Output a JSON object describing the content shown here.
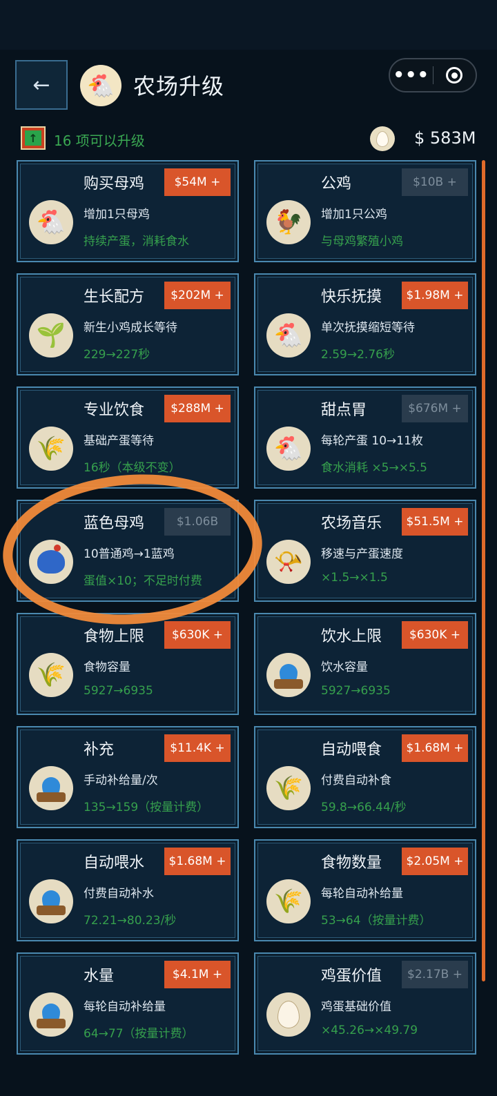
{
  "header": {
    "back_icon": "←",
    "title": "农场升级",
    "more_icon": "•••"
  },
  "info": {
    "upgrade_count": "16 项可以升级",
    "money": "$ 583M"
  },
  "colors": {
    "accent": "#d9552a",
    "effect_green": "#36a04d",
    "card_border": "#4a89b0",
    "annotation": "#f08a3a"
  },
  "cards": [
    {
      "title": "购买母鸡",
      "price": "$54M +",
      "price_active": true,
      "icon": "hen-icon",
      "desc": "增加1只母鸡",
      "effect": "持续产蛋，消耗食水"
    },
    {
      "title": "公鸡",
      "price": "$10B +",
      "price_active": false,
      "icon": "rooster-icon",
      "desc": "增加1只公鸡",
      "effect": "与母鸡繁殖小鸡"
    },
    {
      "title": "生长配方",
      "price": "$202M +",
      "price_active": true,
      "icon": "sprout-icon",
      "desc": "新生小鸡成长等待",
      "effect": "229→227秒"
    },
    {
      "title": "快乐抚摸",
      "price": "$1.98M +",
      "price_active": true,
      "icon": "petting-hen-icon",
      "desc": "单次抚摸缩短等待",
      "effect": "2.59→2.76秒"
    },
    {
      "title": "专业饮食",
      "price": "$288M +",
      "price_active": true,
      "icon": "grain-sack-icon",
      "desc": "基础产蛋等待",
      "effect": "16秒（本级不变）"
    },
    {
      "title": "甜点胃",
      "price": "$676M +",
      "price_active": false,
      "icon": "petting-hen-icon",
      "desc": "每轮产蛋 10→11枚",
      "effect": "食水消耗 ×5→×5.5"
    },
    {
      "title": "蓝色母鸡",
      "price": "$1.06B",
      "price_active": false,
      "icon": "blue-hen-icon",
      "desc": "10普通鸡→1蓝鸡",
      "effect": "蛋值×10；不足时付费"
    },
    {
      "title": "农场音乐",
      "price": "$51.5M +",
      "price_active": true,
      "icon": "gramophone-icon",
      "desc": "移速与产蛋速度",
      "effect": "×1.5→×1.5"
    },
    {
      "title": "食物上限",
      "price": "$630K +",
      "price_active": true,
      "icon": "grain-sack-icon",
      "desc": "食物容量",
      "effect": "5927→6935"
    },
    {
      "title": "饮水上限",
      "price": "$630K +",
      "price_active": true,
      "icon": "water-drop-icon",
      "desc": "饮水容量",
      "effect": "5927→6935"
    },
    {
      "title": "补充",
      "price": "$11.4K +",
      "price_active": true,
      "icon": "water-drop-icon",
      "desc": "手动补给量/次",
      "effect": "135→159（按量计费）"
    },
    {
      "title": "自动喂食",
      "price": "$1.68M +",
      "price_active": true,
      "icon": "grain-sack-icon",
      "desc": "付费自动补食",
      "effect": "59.8→66.44/秒"
    },
    {
      "title": "自动喂水",
      "price": "$1.68M +",
      "price_active": true,
      "icon": "water-drop-icon",
      "desc": "付费自动补水",
      "effect": "72.21→80.23/秒"
    },
    {
      "title": "食物数量",
      "price": "$2.05M +",
      "price_active": true,
      "icon": "grain-sack-icon",
      "desc": "每轮自动补给量",
      "effect": "53→64（按量计费）"
    },
    {
      "title": "水量",
      "price": "$4.1M +",
      "price_active": true,
      "icon": "water-drop-icon",
      "desc": "每轮自动补给量",
      "effect": "64→77（按量计费）"
    },
    {
      "title": "鸡蛋价值",
      "price": "$2.17B +",
      "price_active": false,
      "icon": "egg-icon",
      "desc": "鸡蛋基础价值",
      "effect": "×45.26→×49.79"
    }
  ]
}
